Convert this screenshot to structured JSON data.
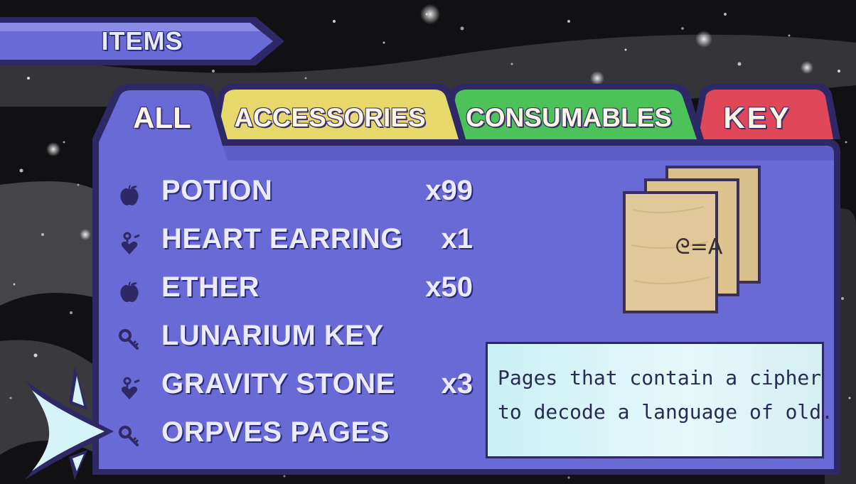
{
  "header": {
    "title": "ITEMS"
  },
  "tabs": [
    {
      "label": "ALL",
      "color": "#6a6ad6",
      "active": true
    },
    {
      "label": "ACCESSORIES",
      "color": "#e6d86a",
      "active": false
    },
    {
      "label": "CONSUMABLES",
      "color": "#4cc258",
      "active": false
    },
    {
      "label": "KEY",
      "color": "#e0485a",
      "active": false
    }
  ],
  "items": [
    {
      "icon": "apple-icon",
      "name": "POTION",
      "qty": "x99"
    },
    {
      "icon": "earring-icon",
      "name": "HEART EARRING",
      "qty": "x1"
    },
    {
      "icon": "apple-icon",
      "name": "ETHER",
      "qty": "x50"
    },
    {
      "icon": "key-icon",
      "name": "LUNARIUM KEY",
      "qty": ""
    },
    {
      "icon": "earring-icon",
      "name": "GRAVITY STONE",
      "qty": "x3"
    },
    {
      "icon": "key-icon",
      "name": "ORPVES PAGES",
      "qty": ""
    }
  ],
  "preview": {
    "icon": "pages-icon",
    "cipher": "ᘓ=A"
  },
  "description": {
    "line1": "Pages that contain a cipher",
    "line2": "to decode a language of old."
  },
  "colors": {
    "panel": "#6a6ad6",
    "panel_dark": "#2e2966",
    "desc_bg": "#d8f3f6",
    "paper": "#e0c89a"
  },
  "cursor": {
    "icon": "pointer-arrow-icon"
  }
}
